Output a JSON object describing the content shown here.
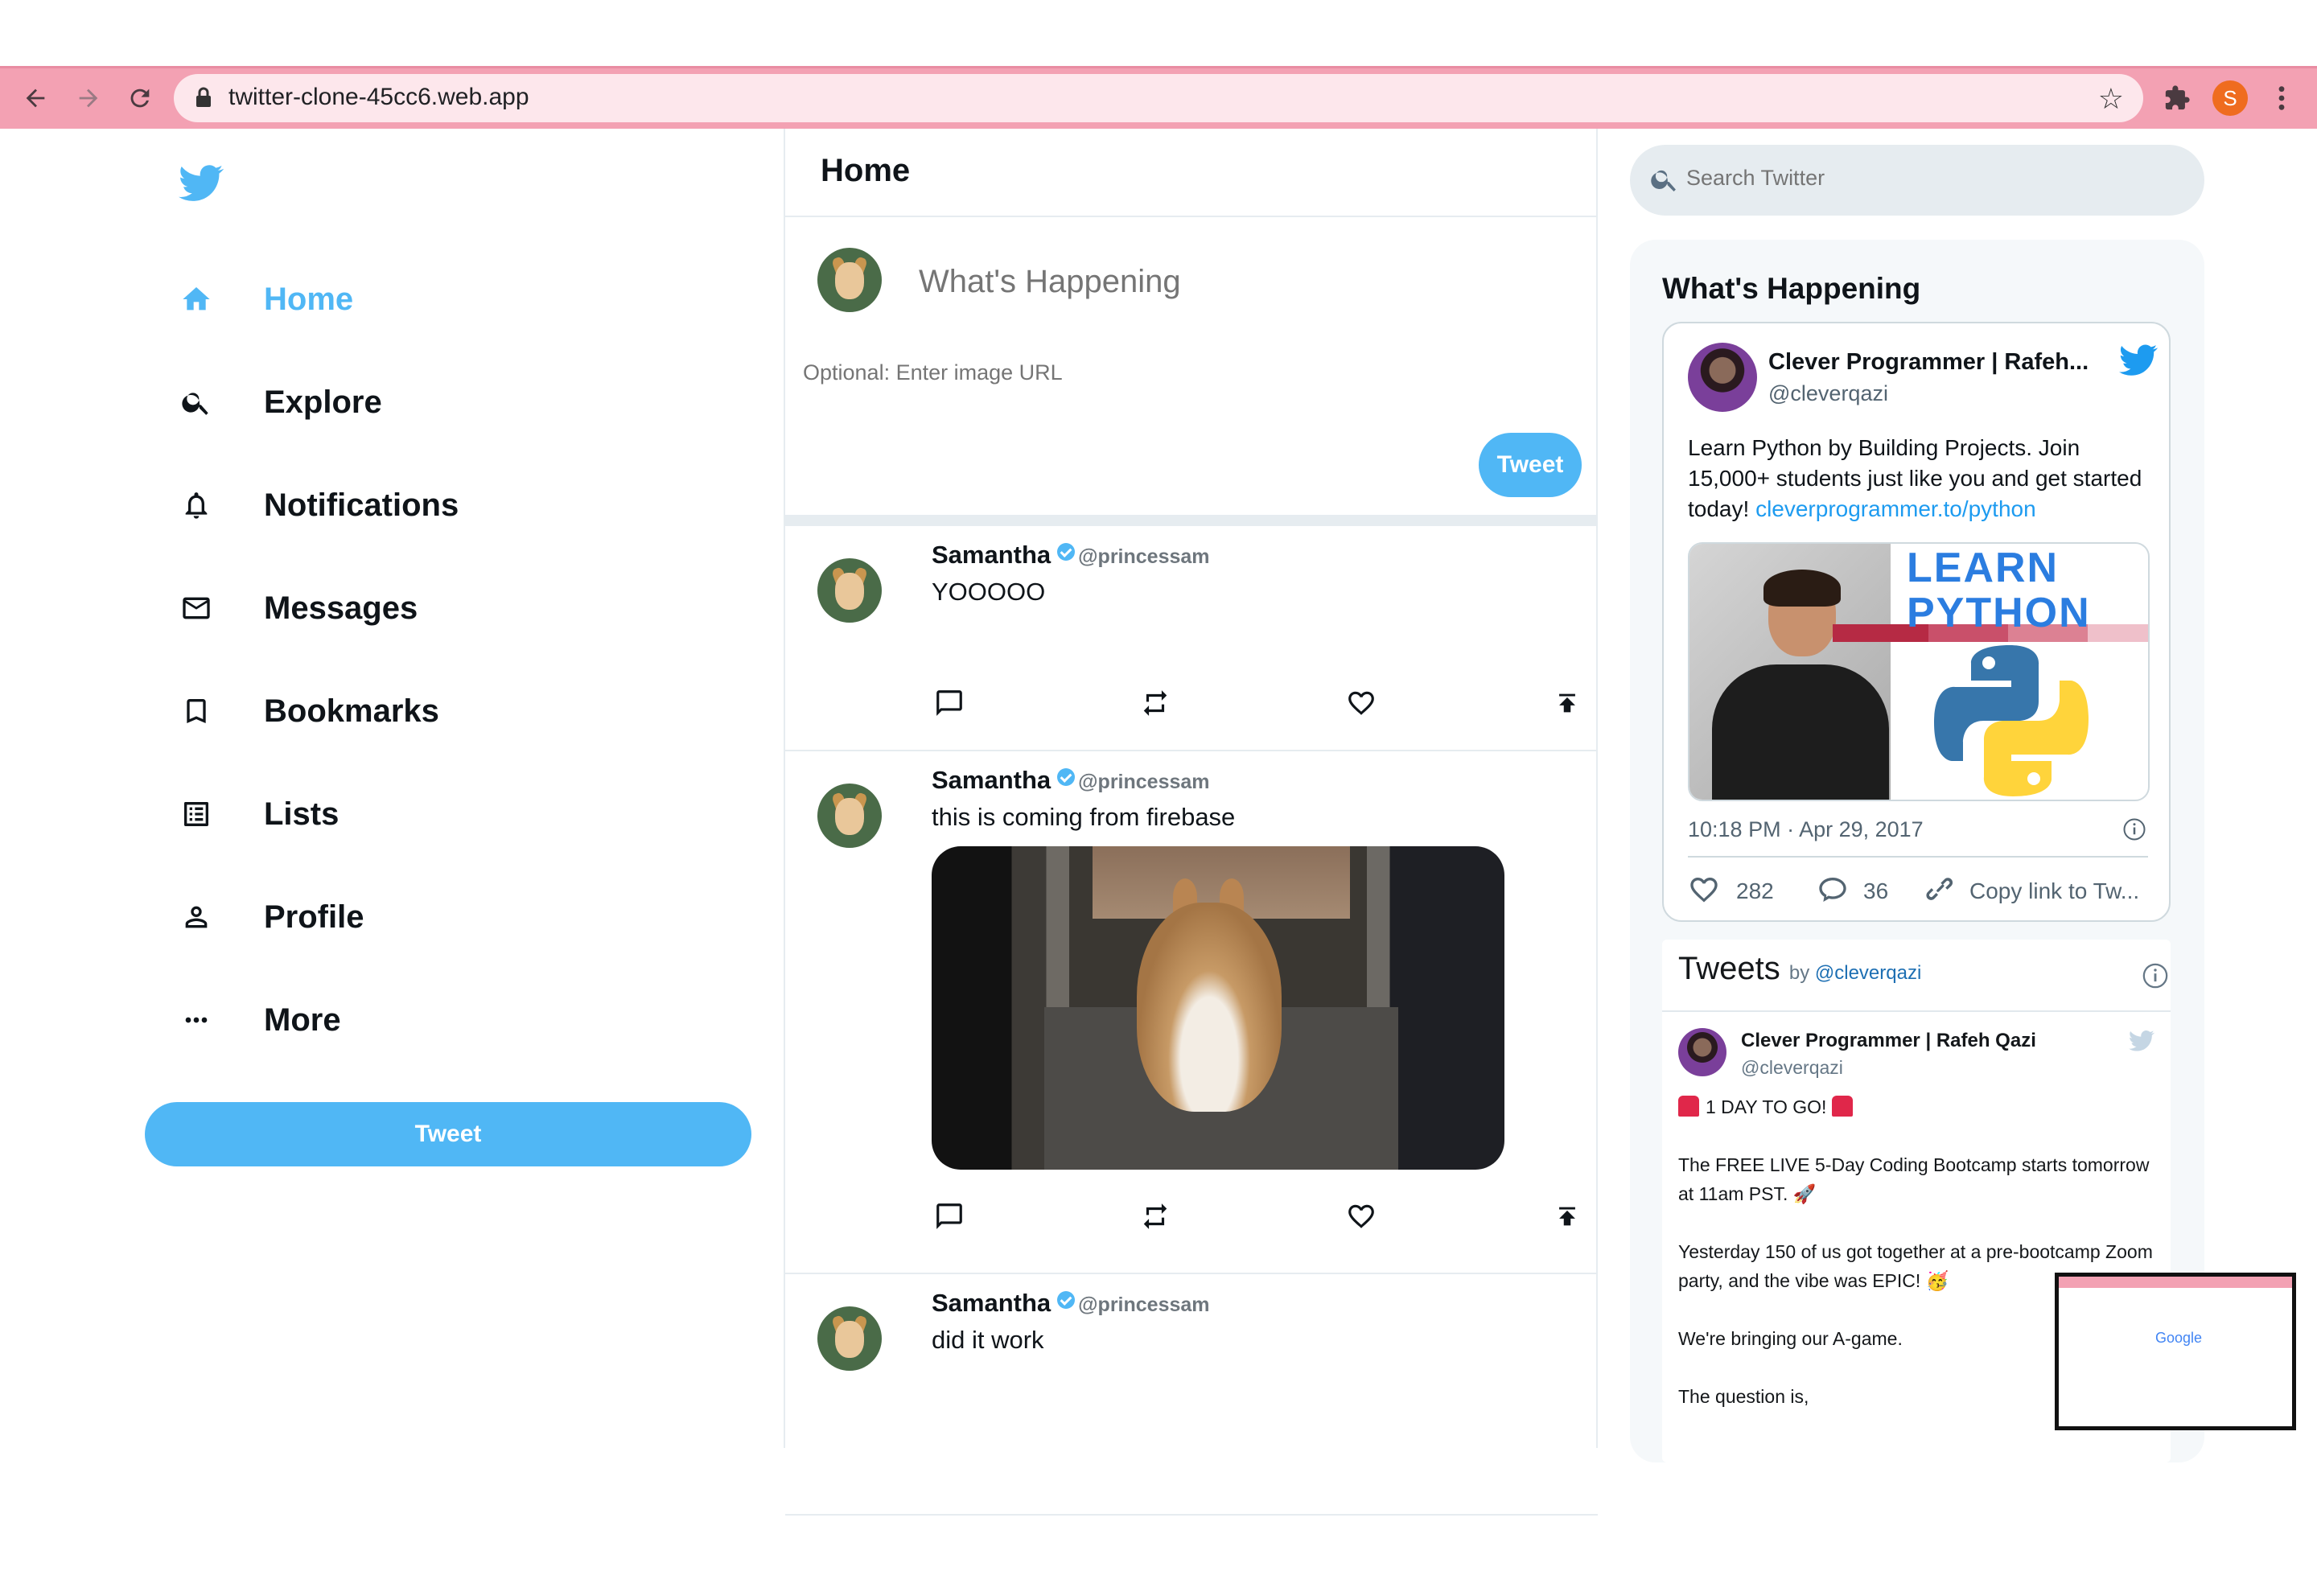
{
  "browser": {
    "url": "twitter-clone-45cc6.web.app",
    "profile_initial": "S",
    "accent": "#f3a1b3"
  },
  "sidebar": {
    "brand_icon": "twitter-bird-icon",
    "items": [
      {
        "label": "Home",
        "icon": "home-icon",
        "active": true
      },
      {
        "label": "Explore",
        "icon": "search-icon"
      },
      {
        "label": "Notifications",
        "icon": "bell-icon"
      },
      {
        "label": "Messages",
        "icon": "mail-icon"
      },
      {
        "label": "Bookmarks",
        "icon": "bookmark-icon"
      },
      {
        "label": "Lists",
        "icon": "list-icon"
      },
      {
        "label": "Profile",
        "icon": "person-icon"
      },
      {
        "label": "More",
        "icon": "more-icon"
      }
    ],
    "tweet_button": "Tweet",
    "accent": "#50b7f5"
  },
  "feed": {
    "title": "Home",
    "tweetbox": {
      "placeholder": "What's Happening",
      "image_placeholder": "Optional: Enter image URL",
      "button": "Tweet"
    },
    "posts": [
      {
        "name": "Samantha",
        "handle": "@princessam",
        "text": "YOOOOO",
        "has_image": false
      },
      {
        "name": "Samantha",
        "handle": "@princessam",
        "text": "this is coming from firebase",
        "has_image": true
      },
      {
        "name": "Samantha",
        "handle": "@princessam",
        "text": "did it work",
        "has_image": false
      }
    ]
  },
  "widgets": {
    "search_placeholder": "Search Twitter",
    "title": "What's Happening",
    "embed": {
      "name": "Clever Programmer | Rafeh...",
      "handle": "@cleverqazi",
      "text": "Learn Python by Building Projects. Join 15,000+ students just like you and get started today!",
      "link": "cleverprogrammer.to/python",
      "image_text_1": "LEARN",
      "image_text_2": "PYTHON",
      "timestamp": "10:18 PM · Apr 29, 2017",
      "likes": "282",
      "replies": "36",
      "copy_link": "Copy link to Tw..."
    },
    "timeline": {
      "title": "Tweets",
      "by": "by",
      "by_handle": "@cleverqazi",
      "name": "Clever Programmer | Rafeh Qazi",
      "handle": "@cleverqazi",
      "lines": [
        "1 DAY TO GO!",
        "The FREE LIVE 5-Day Coding Bootcamp starts tomorrow at 11am PST. 🚀",
        "Yesterday 150 of us got together at a pre-bootcamp Zoom party, and the vibe was EPIC! 🥳",
        "We're bringing our A-game.",
        "The question is,"
      ]
    }
  },
  "mini_window": {
    "label": "Google"
  }
}
